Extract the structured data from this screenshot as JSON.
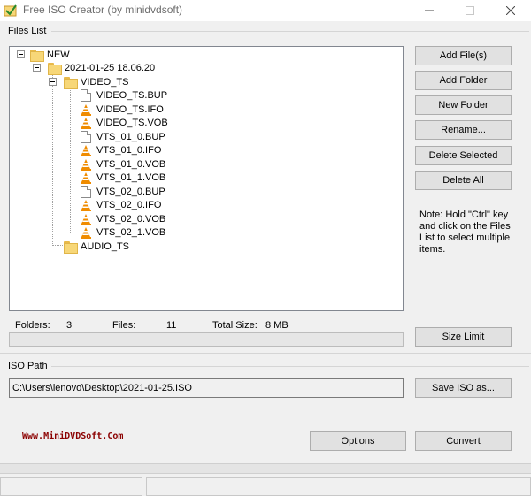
{
  "window": {
    "title": "Free ISO Creator (by minidvdsoft)",
    "minimize": "—",
    "maximize": "☐",
    "close": "✕"
  },
  "files_list": {
    "group_label": "Files List",
    "tree": [
      {
        "label": "NEW",
        "icon": "folder"
      },
      {
        "label": "2021-01-25 18.06.20",
        "icon": "folder"
      },
      {
        "label": "VIDEO_TS",
        "icon": "folder"
      },
      {
        "label": "VIDEO_TS.BUP",
        "icon": "file"
      },
      {
        "label": "VIDEO_TS.IFO",
        "icon": "vlc-cone"
      },
      {
        "label": "VIDEO_TS.VOB",
        "icon": "vlc-cone"
      },
      {
        "label": "VTS_01_0.BUP",
        "icon": "file"
      },
      {
        "label": "VTS_01_0.IFO",
        "icon": "vlc-cone"
      },
      {
        "label": "VTS_01_0.VOB",
        "icon": "vlc-cone"
      },
      {
        "label": "VTS_01_1.VOB",
        "icon": "vlc-cone"
      },
      {
        "label": "VTS_02_0.BUP",
        "icon": "file"
      },
      {
        "label": "VTS_02_0.IFO",
        "icon": "vlc-cone"
      },
      {
        "label": "VTS_02_0.VOB",
        "icon": "vlc-cone"
      },
      {
        "label": "VTS_02_1.VOB",
        "icon": "vlc-cone"
      },
      {
        "label": "AUDIO_TS",
        "icon": "folder"
      }
    ]
  },
  "buttons": {
    "add_files": "Add File(s)",
    "add_folder": "Add Folder",
    "new_folder": "New Folder",
    "rename": "Rename...",
    "delete_selected": "Delete Selected",
    "delete_all": "Delete All",
    "size_limit": "Size Limit",
    "save_iso_as": "Save ISO as...",
    "options": "Options",
    "convert": "Convert"
  },
  "note": "Note: Hold \"Ctrl\" key and click on the Files List to select multiple items.",
  "stats": {
    "folders_label": "Folders:",
    "folders_value": "3",
    "files_label": "Files:",
    "files_value": "11",
    "total_size_label": "Total Size:",
    "total_size_value": "8 MB"
  },
  "progress": {
    "fraction": 0.0,
    "color": "#06b025"
  },
  "iso_path": {
    "group_label": "ISO Path",
    "value": "C:\\Users\\lenovo\\Desktop\\2021-01-25.ISO"
  },
  "site_link": "Www.MiniDVDSoft.Com",
  "colors": {
    "site_link": "#8b0000",
    "folder": "#f7d778",
    "vlc_orange": "#f08c00"
  }
}
